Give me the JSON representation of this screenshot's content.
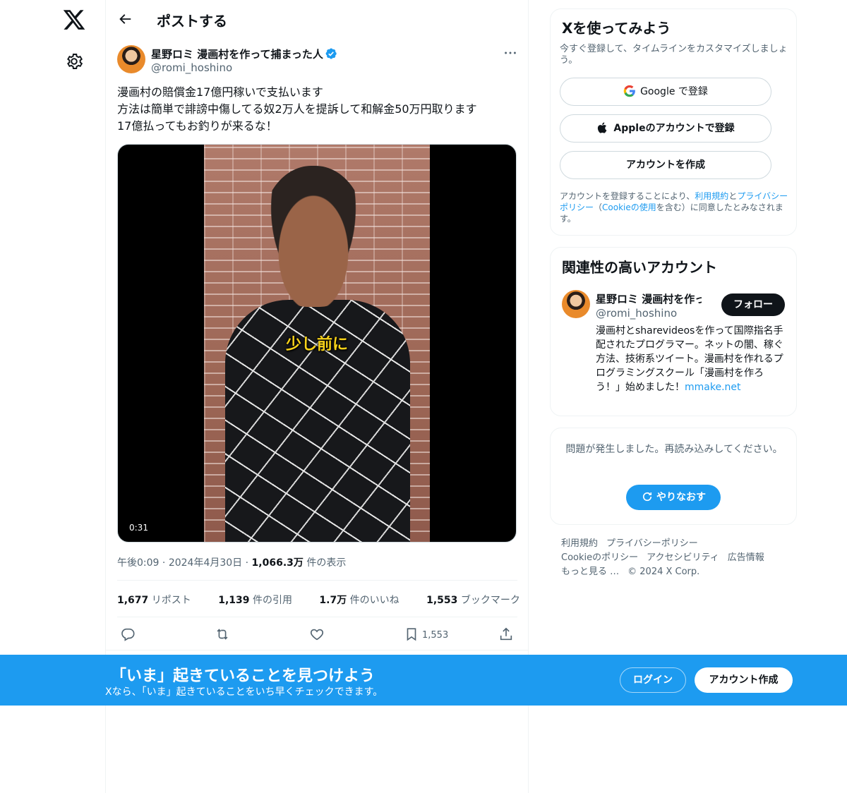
{
  "nav": {
    "home_icon": "x-logo-icon",
    "settings_icon": "gear-icon"
  },
  "header": {
    "title": "ポストする"
  },
  "post": {
    "author_name": "星野ロミ 漫画村を作って捕まった人",
    "handle": "@romi_hoshino",
    "lines": [
      "漫画村の賠償金17億円稼いで支払います",
      "方法は簡単で誹謗中傷してる奴2万人を提訴して和解金50万円取ります",
      "17億払ってもお釣りが来るな！"
    ],
    "video_caption": "少し前に",
    "video_duration": "0:31",
    "time": "午後0:09",
    "date": "2024年4月30日",
    "views_num": "1,066.3万",
    "views_label": " 件の表示",
    "stats": {
      "reposts_num": "1,677",
      "reposts_label": " リポスト",
      "quotes_num": "1,139",
      "quotes_label": " 件の引用",
      "likes_num": "1.7万",
      "likes_label": " 件のいいね",
      "bookmarks_num": "1,553",
      "bookmarks_label": " ブックマーク"
    },
    "bookmark_count": "1,553"
  },
  "signup_card": {
    "title": "Xを使ってみよう",
    "subtitle": "今すぐ登録して、タイムラインをカスタマイズしましょう。",
    "google_label": "Google で登録",
    "apple_label": "Appleのアカウントで登録",
    "create_label": "アカウントを作成",
    "legal_1": "アカウントを登録することにより、",
    "legal_terms": "利用規約",
    "legal_2": "と",
    "legal_privacy": "プライバシーポリシー",
    "legal_3": "（",
    "legal_cookie": "Cookieの使用",
    "legal_4": "を含む）に同意したとみなされます。"
  },
  "related": {
    "title": "関連性の高いアカウント",
    "name": "星野ロミ 漫画村を作っ",
    "handle": "@romi_hoshino",
    "follow_label": "フォロー",
    "bio": "漫画村とsharevideosを作って国際指名手配されたプログラマー。ネットの闇、稼ぐ方法、技術系ツイート。漫画村を作れるプログラミングスクール「漫画村を作ろう！」始めました！",
    "bio_link": "mmake.net"
  },
  "error_card": {
    "message": "問題が発生しました。再読み込みしてください。",
    "retry_label": "やりなおす"
  },
  "footer": {
    "links": [
      "利用規約",
      "プライバシーポリシー",
      "Cookieのポリシー",
      "アクセシビリティ",
      "広告情報",
      "もっと見る …",
      "© 2024 X Corp."
    ]
  },
  "banner": {
    "title": "「いま」起きていることを見つけよう",
    "subtitle": "Xなら、「いま」起きていることをいち早くチェックできます。",
    "login_label": "ログイン",
    "signup_label": "アカウント作成"
  },
  "colors": {
    "accent": "#1d9bf0",
    "text": "#0f1419",
    "secondary": "#536471"
  }
}
